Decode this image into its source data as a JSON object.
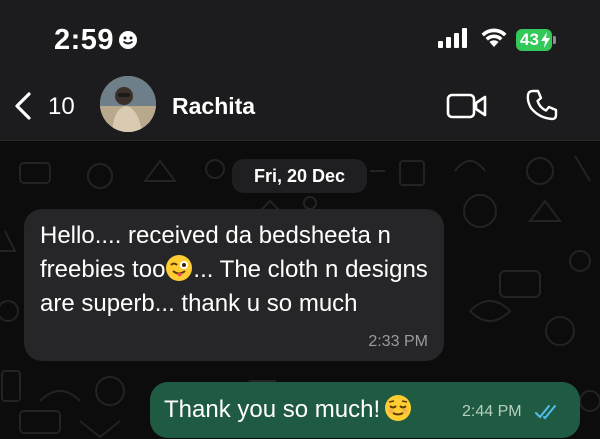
{
  "status_bar": {
    "time": "2:59",
    "battery": "43"
  },
  "header": {
    "back_count": "10",
    "contact_name": "Rachita"
  },
  "chat": {
    "date": "Fri, 20 Dec",
    "messages": [
      {
        "direction": "incoming",
        "text_part1": "Hello.... received da bedsheeta n freebies too",
        "emoji": "winking-face-with-tongue",
        "text_part2": "... The cloth n designs are superb... thank u so much",
        "time": "2:33 PM"
      },
      {
        "direction": "outgoing",
        "text": "Thank you so much!",
        "emoji": "relieved-face",
        "time": "2:44 PM",
        "status": "read"
      }
    ]
  },
  "colors": {
    "header_bg": "#1c1c1e",
    "chat_bg": "#0c0c0c",
    "incoming_bubble": "#262628",
    "outgoing_bubble": "#1f5b43",
    "read_ticks": "#53bdeb",
    "battery": "#34c759"
  }
}
